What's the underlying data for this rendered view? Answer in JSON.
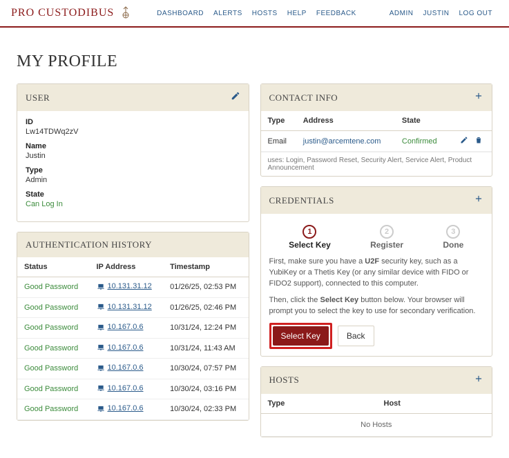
{
  "brand": "PRO CUSTODIBUS",
  "nav": {
    "dashboard": "DASHBOARD",
    "alerts": "ALERTS",
    "hosts": "HOSTS",
    "help": "HELP",
    "feedback": "FEEDBACK",
    "admin": "ADMIN",
    "user": "JUSTIN",
    "logout": "LOG OUT"
  },
  "page_title": "MY PROFILE",
  "user_panel": {
    "title": "USER",
    "id_label": "ID",
    "id_value": "Lw14TDWq2zV",
    "name_label": "Name",
    "name_value": "Justin",
    "type_label": "Type",
    "type_value": "Admin",
    "state_label": "State",
    "state_value": "Can Log In"
  },
  "auth_panel": {
    "title": "AUTHENTICATION HISTORY",
    "cols": {
      "status": "Status",
      "ip": "IP Address",
      "ts": "Timestamp"
    },
    "rows": [
      {
        "status": "Good Password",
        "ip": "10.131.31.12",
        "ts": "01/26/25, 02:53 PM"
      },
      {
        "status": "Good Password",
        "ip": "10.131.31.12",
        "ts": "01/26/25, 02:46 PM"
      },
      {
        "status": "Good Password",
        "ip": "10.167.0.6",
        "ts": "10/31/24, 12:24 PM"
      },
      {
        "status": "Good Password",
        "ip": "10.167.0.6",
        "ts": "10/31/24, 11:43 AM"
      },
      {
        "status": "Good Password",
        "ip": "10.167.0.6",
        "ts": "10/30/24, 07:57 PM"
      },
      {
        "status": "Good Password",
        "ip": "10.167.0.6",
        "ts": "10/30/24, 03:16 PM"
      },
      {
        "status": "Good Password",
        "ip": "10.167.0.6",
        "ts": "10/30/24, 02:33 PM"
      }
    ]
  },
  "contact_panel": {
    "title": "CONTACT INFO",
    "cols": {
      "type": "Type",
      "address": "Address",
      "state": "State"
    },
    "row": {
      "type": "Email",
      "address": "justin@arcemtene.com",
      "state": "Confirmed"
    },
    "uses": "uses: Login, Password Reset, Security Alert, Service Alert, Product Announcement"
  },
  "creds_panel": {
    "title": "CREDENTIALS",
    "steps": [
      {
        "num": "1",
        "label": "Select Key"
      },
      {
        "num": "2",
        "label": "Register"
      },
      {
        "num": "3",
        "label": "Done"
      }
    ],
    "instr1_a": "First, make sure you have a ",
    "instr1_b": "U2F",
    "instr1_c": " security key, such as a YubiKey or a Thetis Key (or any similar device with FIDO or FIDO2 support), connected to this computer.",
    "instr2_a": "Then, click the ",
    "instr2_b": "Select Key",
    "instr2_c": " button below. Your browser will prompt you to select the key to use for secondary verification.",
    "btn_primary": "Select Key",
    "btn_back": "Back"
  },
  "hosts_panel": {
    "title": "HOSTS",
    "cols": {
      "type": "Type",
      "host": "Host"
    },
    "empty": "No Hosts"
  }
}
